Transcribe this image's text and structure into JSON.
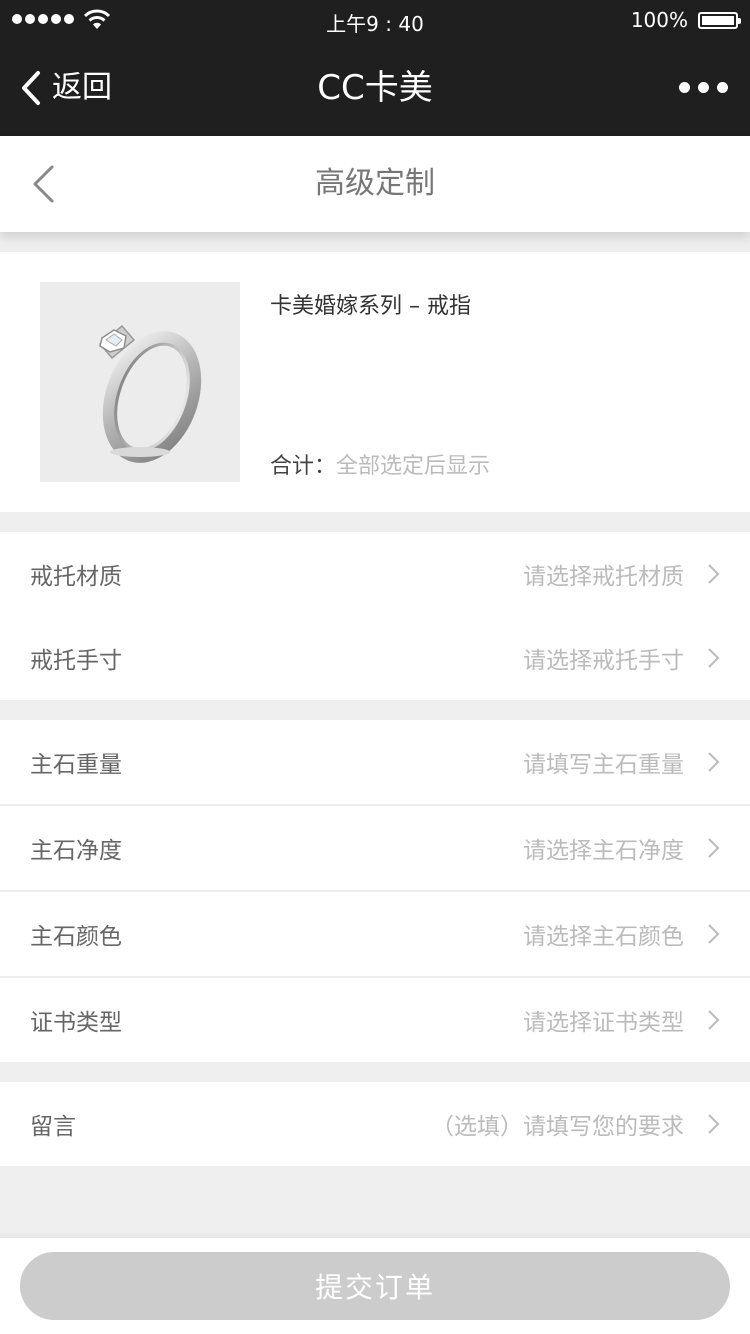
{
  "status_bar": {
    "time": "上午9 : 40",
    "battery": "100%"
  },
  "nav": {
    "back_label": "返回",
    "title": "CC卡美"
  },
  "page": {
    "title": "高级定制"
  },
  "product": {
    "name": "卡美婚嫁系列 – 戒指",
    "total_label": "合计：",
    "total_value": "全部选定后显示"
  },
  "groups": [
    {
      "rows": [
        {
          "label": "戒托材质",
          "placeholder": "请选择戒托材质"
        },
        {
          "label": "戒托手寸",
          "placeholder": "请选择戒托手寸"
        }
      ]
    },
    {
      "rows": [
        {
          "label": "主石重量",
          "placeholder": "请填写主石重量"
        },
        {
          "label": "主石净度",
          "placeholder": "请选择主石净度"
        },
        {
          "label": "主石颜色",
          "placeholder": "请选择主石颜色"
        },
        {
          "label": "证书类型",
          "placeholder": "请选择证书类型"
        }
      ]
    },
    {
      "rows": [
        {
          "label": "留言",
          "placeholder": "（选填）请填写您的要求"
        }
      ]
    }
  ],
  "footer": {
    "submit_label": "提交订单"
  },
  "colors": {
    "nav_background": "#1f1f1f",
    "page_background": "#efefef",
    "submit_disabled": "#cccccc"
  }
}
